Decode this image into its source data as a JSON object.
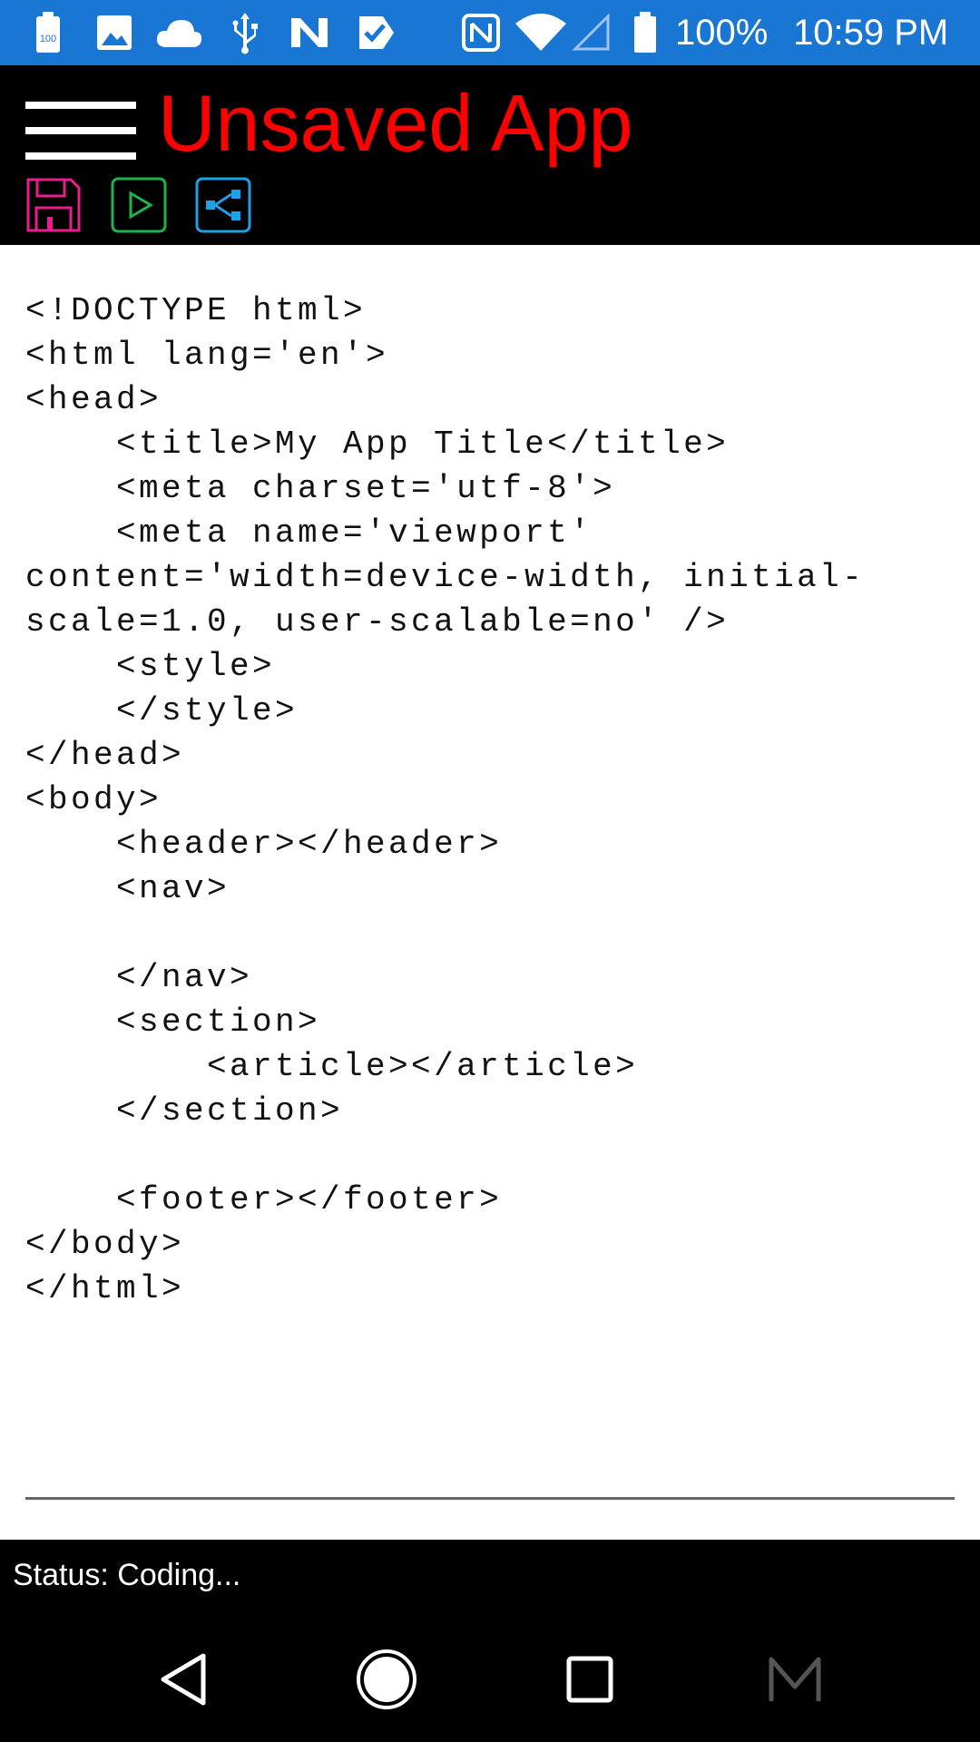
{
  "status_bar": {
    "battery_saver_badge": "100",
    "battery_percent": "100%",
    "time": "10:59 PM",
    "icons": [
      "battery-saver-icon",
      "image-icon",
      "cloud-icon",
      "usb-icon",
      "n-app-icon",
      "check-tag-icon",
      "nfc-icon",
      "wifi-icon",
      "signal-icon",
      "battery-icon"
    ],
    "color": "#1976d2"
  },
  "app_bar": {
    "title": "Unsaved App",
    "title_color": "#ff0000",
    "menu_icon": "hamburger-menu-icon",
    "tools": [
      {
        "name": "save",
        "icon": "floppy-disk-icon",
        "color": "#e91e8c"
      },
      {
        "name": "run",
        "icon": "play-icon",
        "color": "#1fb34a"
      },
      {
        "name": "share",
        "icon": "share-icon",
        "color": "#1ea0e6"
      }
    ]
  },
  "editor": {
    "code": "<!DOCTYPE html>\n<html lang='en'>\n<head>\n    <title>My App Title</title>\n    <meta charset='utf-8'>\n    <meta name='viewport'\ncontent='width=device-width, initial-\nscale=1.0, user-scalable=no' />\n    <style>\n    </style>\n</head>\n<body>\n    <header></header>\n    <nav>\n\n    </nav>\n    <section>\n        <article></article>\n    </section>\n\n    <footer></footer>\n</body>\n</html>"
  },
  "status": {
    "text": "Status: Coding..."
  },
  "nav_bar": {
    "buttons": [
      "back-icon",
      "home-icon",
      "recents-icon",
      "m-app-icon"
    ]
  }
}
